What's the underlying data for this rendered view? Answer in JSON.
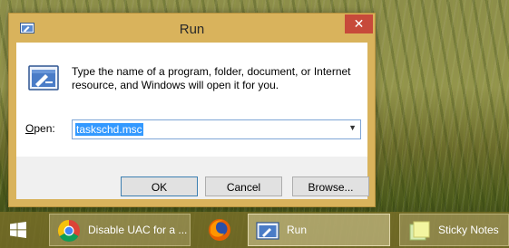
{
  "dialog": {
    "title": "Run",
    "close_glyph": "✕",
    "description": "Type the name of a program, folder, document, or Internet resource, and Windows will open it for you.",
    "open_label_accel": "O",
    "open_label_rest": "pen:",
    "command_value": "taskschd.msc",
    "buttons": {
      "ok": "OK",
      "cancel": "Cancel",
      "browse": "Browse..."
    }
  },
  "taskbar": {
    "items": [
      {
        "label": "Disable UAC for a ...",
        "icon": "chrome-icon"
      },
      {
        "label": "",
        "icon": "firefox-icon"
      },
      {
        "label": "Run",
        "icon": "run-icon"
      },
      {
        "label": "Sticky Notes",
        "icon": "sticky-notes-icon"
      }
    ],
    "start_icon": "windows-logo-icon"
  },
  "colors": {
    "title_bar": "#d9b35c",
    "close_button": "#c74a3a",
    "selection": "#3399ff"
  }
}
